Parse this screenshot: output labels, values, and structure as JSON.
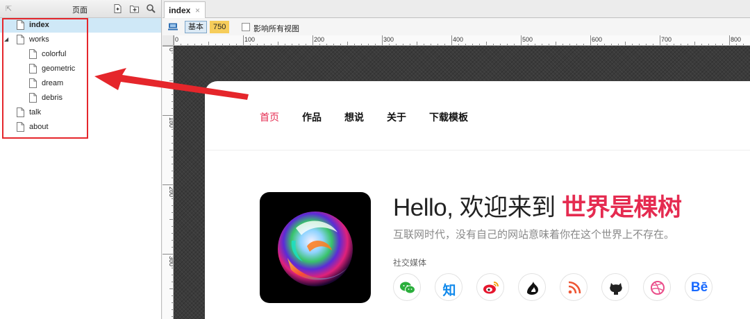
{
  "pages_panel": {
    "title": "页面",
    "pages": [
      {
        "label": "index",
        "level": 0,
        "selected": true
      },
      {
        "label": "works",
        "level": 0,
        "expanded": true
      },
      {
        "label": "colorful",
        "level": 1
      },
      {
        "label": "geometric",
        "level": 1
      },
      {
        "label": "dream",
        "level": 1
      },
      {
        "label": "debris",
        "level": 1
      },
      {
        "label": "talk",
        "level": 0
      },
      {
        "label": "about",
        "level": 0
      }
    ]
  },
  "annotation": {
    "color": "#e5262b"
  },
  "editor": {
    "tab": {
      "label": "index",
      "close": "×"
    },
    "toolbar": {
      "view_base": "基本",
      "view_width": "750",
      "affect_all_label": "影响所有视图",
      "affect_all_checked": false
    },
    "ruler_h_labels": [
      "0",
      "100",
      "200",
      "300",
      "400",
      "500",
      "600",
      "700",
      "800"
    ],
    "ruler_v_labels": [
      "0",
      "100",
      "200",
      "300"
    ]
  },
  "site": {
    "nav": [
      {
        "label": "首页",
        "active": true
      },
      {
        "label": "作品"
      },
      {
        "label": "想说"
      },
      {
        "label": "关于"
      },
      {
        "label": "下载模板"
      }
    ],
    "hero": {
      "title_prefix": "Hello, 欢迎来到 ",
      "title_accent": "世界是棵树",
      "subtitle": "互联网时代，没有自己的网站意味着你在这个世界上不存在。",
      "social_label": "社交媒体"
    },
    "social": [
      {
        "name": "wechat",
        "icon": "wechat-icon",
        "color": "#2aae3b"
      },
      {
        "name": "zhihu",
        "icon": "zhihu-icon",
        "text": "知",
        "color": "#0f88eb"
      },
      {
        "name": "weibo",
        "icon": "weibo-icon",
        "color": "#e6162d"
      },
      {
        "name": "douban",
        "icon": "flame-icon",
        "color": "#111111"
      },
      {
        "name": "rss",
        "icon": "rss-icon",
        "color": "#ee5533"
      },
      {
        "name": "github",
        "icon": "github-icon",
        "color": "#222222"
      },
      {
        "name": "dribbble",
        "icon": "dribbble-icon",
        "color": "#ea4c89"
      },
      {
        "name": "behance",
        "icon": "behance-icon",
        "text": "Bē",
        "color": "#1769ff"
      }
    ],
    "accent_color": "#e52b50"
  }
}
